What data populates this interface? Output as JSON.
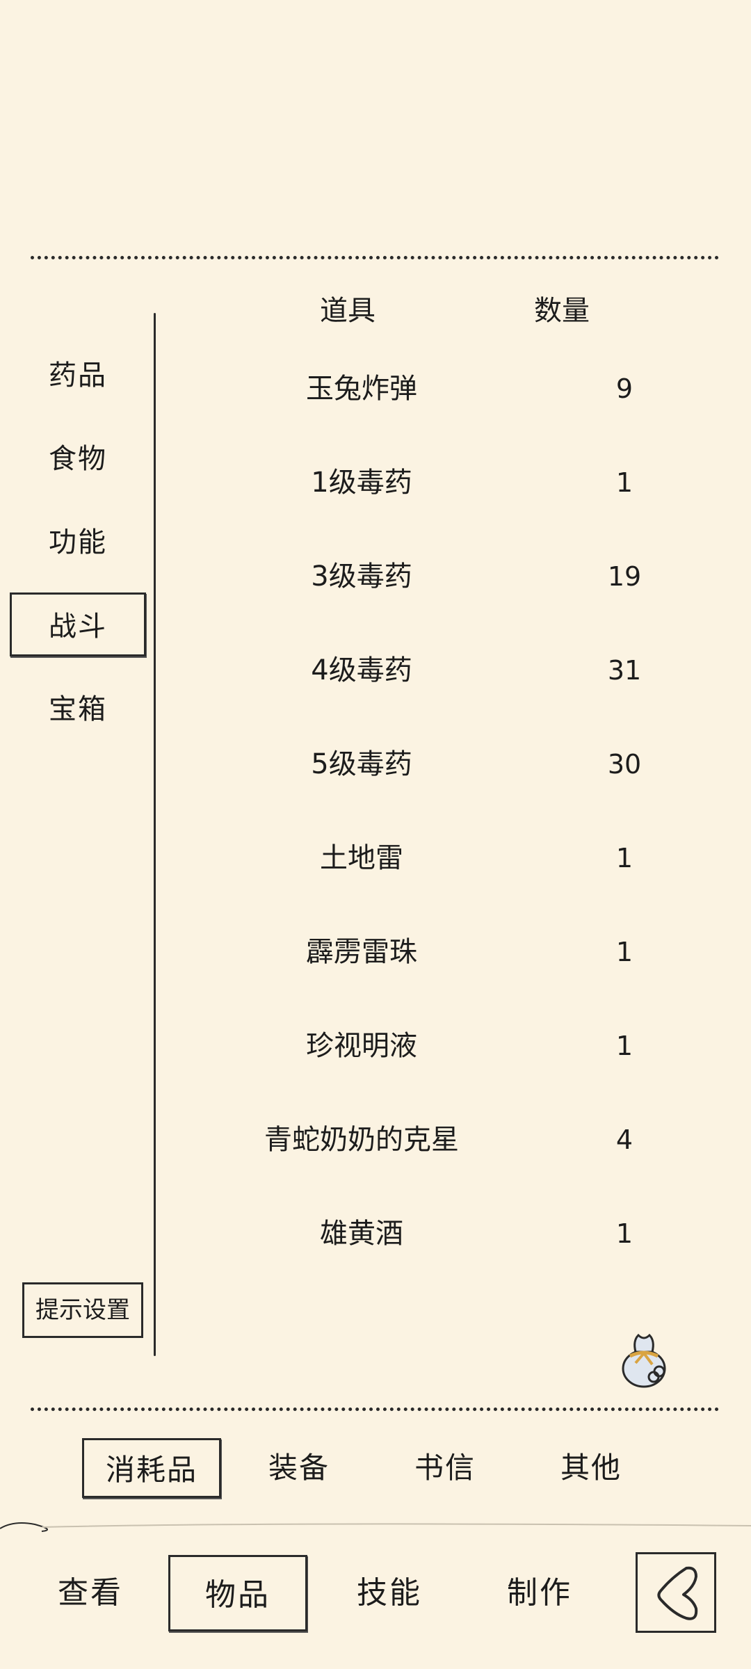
{
  "columns": {
    "item": "道具",
    "quantity": "数量"
  },
  "categories": [
    {
      "label": "药品"
    },
    {
      "label": "食物"
    },
    {
      "label": "功能"
    },
    {
      "label": "战斗",
      "active": true
    },
    {
      "label": "宝箱"
    }
  ],
  "hint_settings_label": "提示设置",
  "items": [
    {
      "name": "玉兔炸弹",
      "qty": "9"
    },
    {
      "name": "1级毒药",
      "qty": "1"
    },
    {
      "name": "3级毒药",
      "qty": "19"
    },
    {
      "name": "4级毒药",
      "qty": "31"
    },
    {
      "name": "5级毒药",
      "qty": "30"
    },
    {
      "name": "土地雷",
      "qty": "1"
    },
    {
      "name": "霹雳雷珠",
      "qty": "1"
    },
    {
      "name": "珍视明液",
      "qty": "1"
    },
    {
      "name": "青蛇奶奶的克星",
      "qty": "4"
    },
    {
      "name": "雄黄酒",
      "qty": "1"
    }
  ],
  "sub_tabs": [
    {
      "label": "消耗品",
      "active": true
    },
    {
      "label": "装备"
    },
    {
      "label": "书信"
    },
    {
      "label": "其他"
    }
  ],
  "nav_tabs": [
    {
      "label": "查看"
    },
    {
      "label": "物品",
      "active": true
    },
    {
      "label": "技能"
    },
    {
      "label": "制作"
    }
  ],
  "icons": {
    "bag": "loot-bag-icon",
    "back": "back-arrow-icon"
  },
  "colors": {
    "background": "#fbf3e2",
    "ink": "#2a2a2a"
  }
}
